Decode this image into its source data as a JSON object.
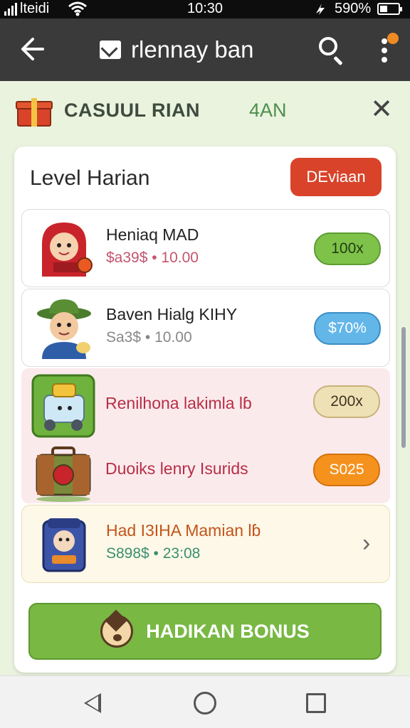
{
  "status_bar": {
    "carrier": "lteidi",
    "time": "10:30",
    "battery": "590%"
  },
  "app_bar": {
    "title": "rlennay ban"
  },
  "banner": {
    "name": "CASUUL RIAN",
    "code": "4AN"
  },
  "panel": {
    "heading": "Level Harian",
    "badge": "DEviaan"
  },
  "items": [
    {
      "title": "Heniaq MAD",
      "subtitle": "$a39$ • 10.00",
      "amount": "100x",
      "pill_color": "#7fc24a",
      "pill_border": "#5e9c33",
      "pill_text": "#1f3d10"
    },
    {
      "title": "Baven Hialg KIHY",
      "subtitle": "Sa3$ • 10.00",
      "amount": "$70%",
      "pill_color": "#63b6e8",
      "pill_border": "#3d8ec4",
      "pill_text": "#ffffff"
    },
    {
      "title": "Renilhona lakimla lɓ",
      "amount": "200x",
      "pill_color": "#efe1b6",
      "pill_border": "#c9b27a",
      "pill_text": "#3d3520"
    },
    {
      "title": "Duoiks lenry Isurids",
      "amount": "S025",
      "pill_color": "#f5921e",
      "pill_border": "#d3720c",
      "pill_text": "#ffffff"
    },
    {
      "title": "Had I3IHA Mamian lɓ",
      "subtitle": "S898$ • 23:08"
    }
  ],
  "bonus_button": {
    "label": "HADIKAN BONUS"
  },
  "icons": {
    "back": "arrow-left-icon",
    "mail": "mail-icon",
    "search": "search-icon",
    "more": "more-vertical-icon",
    "gift": "gift-icon",
    "close": "close-icon",
    "chevron": "chevron-right-icon"
  }
}
